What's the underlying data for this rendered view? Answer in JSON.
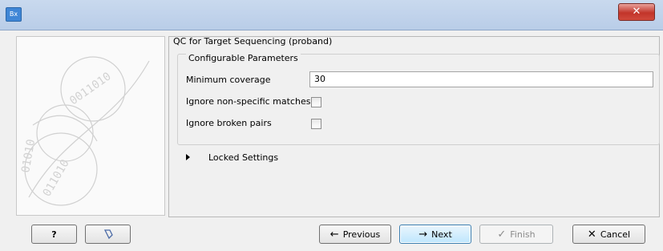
{
  "window": {
    "app_icon_text": "Bx",
    "close_glyph": "✕"
  },
  "main": {
    "title": "QC for Target Sequencing (proband)",
    "group_title": "Configurable Parameters",
    "min_coverage_label": "Minimum coverage",
    "min_coverage_value": "30",
    "ignore_nonspecific_label": "Ignore non-specific matches",
    "ignore_nonspecific_checked": false,
    "ignore_broken_label": "Ignore broken pairs",
    "ignore_broken_checked": false,
    "locked_settings_label": "Locked Settings"
  },
  "buttons": {
    "help": "?",
    "previous": "Previous",
    "next": "Next",
    "finish": "Finish",
    "cancel": "Cancel"
  },
  "icons": {
    "help": "help-icon",
    "reset": "reset-icon",
    "previous": "arrow-left-icon",
    "next": "arrow-right-icon",
    "finish": "checkmark-icon",
    "cancel": "x-icon"
  }
}
